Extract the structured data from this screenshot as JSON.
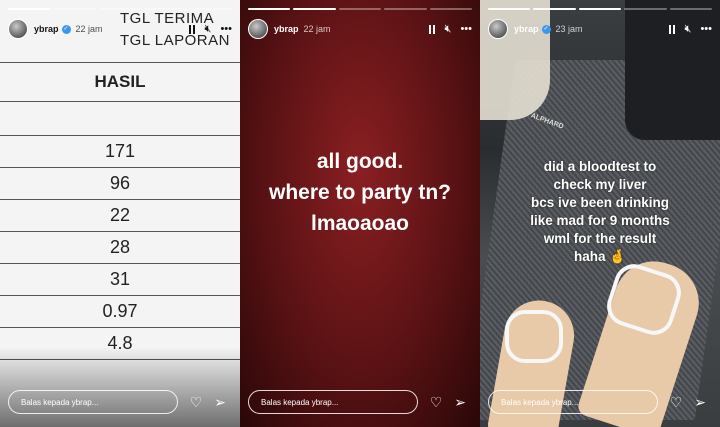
{
  "panels": [
    {
      "progress": [
        1,
        0,
        0,
        0,
        0
      ],
      "username": "ybrap",
      "time": "22 jam",
      "doc": {
        "line1": "TGL TERIMA",
        "line2": "TGL LAPORAN",
        "header": "HASIL",
        "values": [
          "171",
          "96",
          "22",
          "28",
          "31",
          "0.97",
          "4.8"
        ]
      },
      "reply_placeholder": "Balas kepada ybrap..."
    },
    {
      "progress": [
        1,
        1,
        0,
        0,
        0
      ],
      "username": "ybrap",
      "time": "22 jam",
      "text_lines": [
        "all good.",
        "where to party tn?",
        "lmaoaoao"
      ],
      "reply_placeholder": "Balas kepada ybrap..."
    },
    {
      "progress": [
        1,
        1,
        1,
        0,
        0
      ],
      "username": "ybrap",
      "time": "23 jam",
      "mat_brand": "ALPHARD",
      "text_lines": [
        "did a bloodtest to",
        "check my liver",
        "bcs ive been drinking",
        "like mad for 9 months",
        "wml for the result",
        "haha 🤞"
      ],
      "reply_placeholder": "Balas kepada ybrap..."
    }
  ],
  "icons": {
    "verified": "verified-badge-icon",
    "pause": "pause-icon",
    "mute": "mute-icon",
    "more": "more-icon",
    "like": "heart-icon",
    "send": "send-icon"
  }
}
